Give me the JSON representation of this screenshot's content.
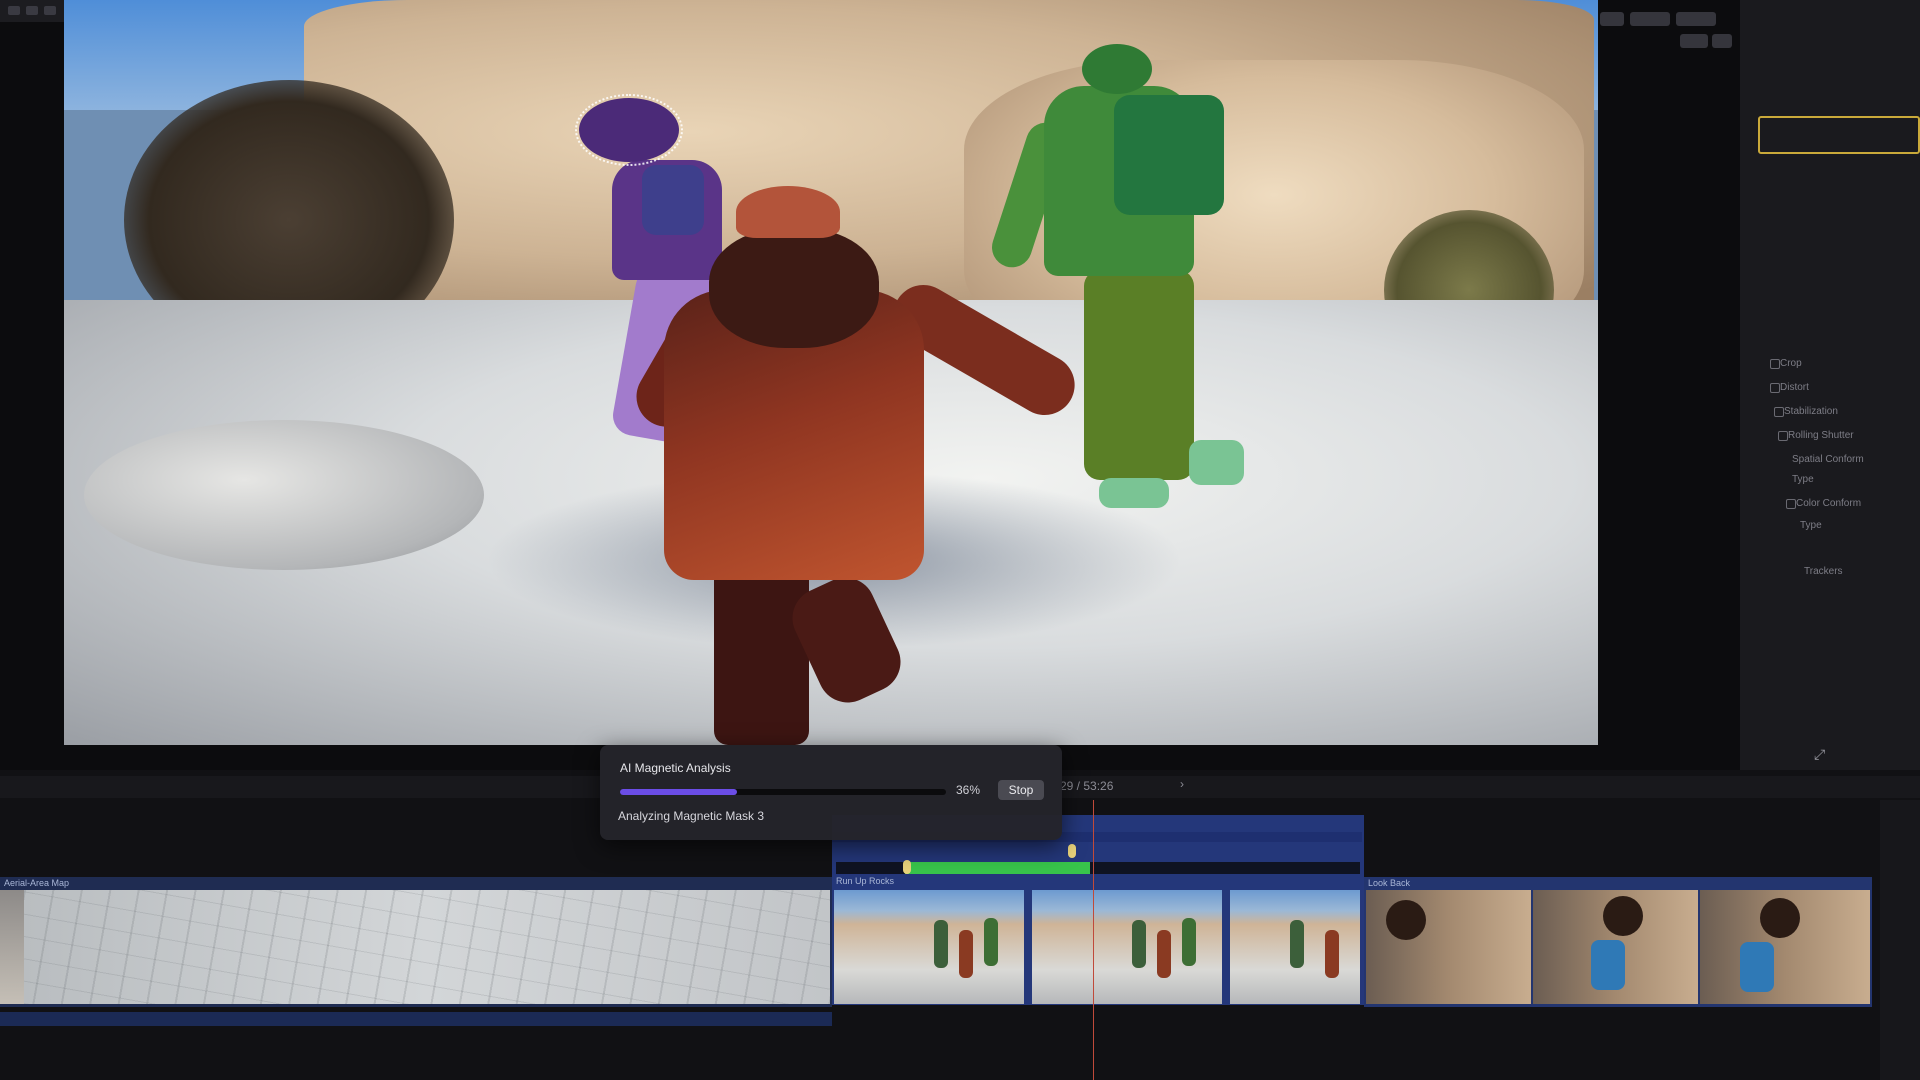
{
  "progress": {
    "title": "AI Magnetic Analysis",
    "percent_label": "36%",
    "fraction": 0.36,
    "stop_label": "Stop",
    "status": "Analyzing Magnetic Mask 3"
  },
  "timeline": {
    "timecode": "29 / 53:26",
    "clips": {
      "map": "Aerial-Area Map",
      "run": "Run Up Rocks",
      "look": "Look Back"
    }
  },
  "inspector": {
    "items": [
      "Crop",
      "Distort",
      "Stabilization",
      "Rolling Shutter",
      "Spatial Conform",
      "Type",
      "Color Conform",
      "Type",
      "Trackers"
    ]
  },
  "colors": {
    "accent": "#6b4de6",
    "selection": "#c9a93a",
    "clip_blue": "#24377a",
    "analysis_green": "#38c44b"
  },
  "icons": {
    "fullscreen": "fullscreen-icon",
    "play": "play-icon"
  }
}
